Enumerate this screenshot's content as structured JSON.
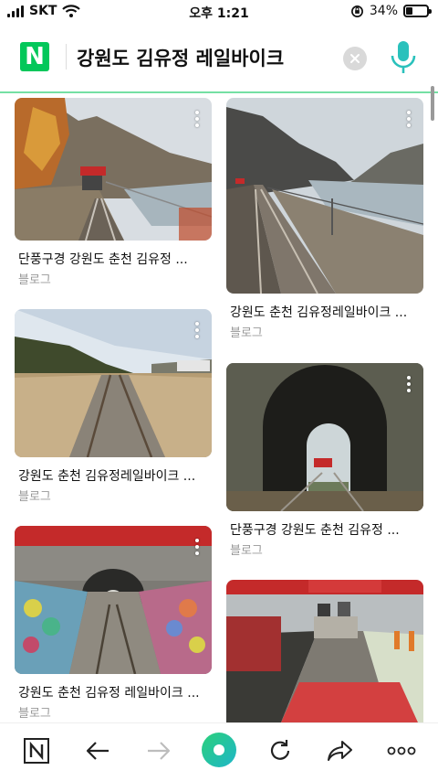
{
  "status": {
    "carrier": "SKT",
    "time": "오후 1:21",
    "battery_text": "34%",
    "battery_level": 0.34
  },
  "search": {
    "logo": "N",
    "query": "강원도 김유정 레일바이크",
    "clear_icon": "close-icon",
    "mic_icon": "microphone-icon",
    "accent": "#03c75a"
  },
  "results": [
    {
      "title": "단풍구경 강원도 춘천 김유정 ...",
      "source": "블로그",
      "scene": "autumn-river-rail"
    },
    {
      "title": "강원도 춘천 김유정레일바이크 ...",
      "source": "블로그",
      "scene": "river-cliff-rail"
    },
    {
      "title": "강원도 춘천 김유정레일바이크 ...",
      "source": "블로그",
      "scene": "reed-field-rail"
    },
    {
      "title": "단풍구경 강원도 춘천 김유정 ...",
      "source": "블로그",
      "scene": "stone-tunnel"
    },
    {
      "title": "강원도 춘천 김유정 레일바이크 ...",
      "source": "블로그",
      "scene": "pinwheel-tunnel"
    },
    {
      "title": "",
      "source": "",
      "scene": "railbike-station"
    }
  ],
  "toolbar": {
    "items": [
      "naver-home-icon",
      "back-arrow-icon",
      "forward-arrow-icon",
      "green-dot-icon",
      "reload-icon",
      "share-icon",
      "more-icon"
    ]
  }
}
